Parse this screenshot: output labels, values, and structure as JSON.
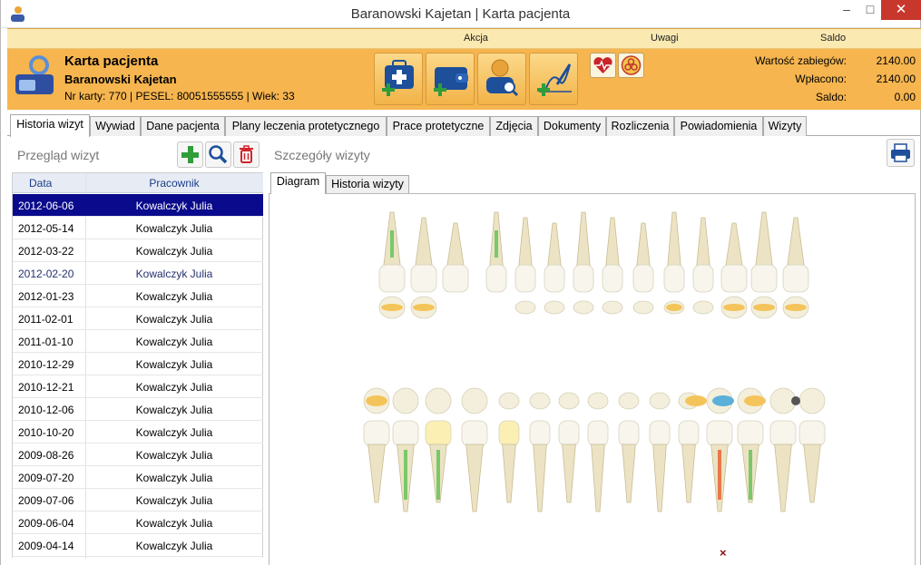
{
  "window": {
    "title": "Baranowski Kajetan | Karta pacjenta",
    "minimize": "–",
    "maximize": "□",
    "close": "✕"
  },
  "header": {
    "col_akcja": "Akcja",
    "col_uwagi": "Uwagi",
    "col_saldo": "Saldo",
    "card_title": "Karta pacjenta",
    "patient_name": "Baranowski Kajetan",
    "patient_info": "Nr karty: 770 | PESEL: 80051555555 | Wiek: 33",
    "actions": [
      "add-medical-kit-icon",
      "add-wallet-icon",
      "search-user-icon",
      "add-signature-icon"
    ],
    "notes": [
      "heart-pulse-icon",
      "biohazard-icon"
    ],
    "summary": [
      {
        "label": "Wartość zabiegów:",
        "value": "2140.00"
      },
      {
        "label": "Wpłacono:",
        "value": "2140.00"
      },
      {
        "label": "Saldo:",
        "value": "0.00"
      }
    ]
  },
  "tabs": [
    "Historia wizyt",
    "Wywiad",
    "Dane pacjenta",
    "Plany leczenia protetycznego",
    "Prace protetyczne",
    "Zdjęcia",
    "Dokumenty",
    "Rozliczenia",
    "Powiadomienia",
    "Wizyty"
  ],
  "active_tab": "Historia wizyt",
  "visits": {
    "title": "Przegląd wizyt",
    "columns": [
      "Data",
      "Pracownik"
    ],
    "rows": [
      {
        "date": "2012-06-06",
        "employee": "Kowalczyk Julia"
      },
      {
        "date": "2012-05-14",
        "employee": "Kowalczyk Julia"
      },
      {
        "date": "2012-03-22",
        "employee": "Kowalczyk Julia"
      },
      {
        "date": "2012-02-20",
        "employee": "Kowalczyk Julia"
      },
      {
        "date": "2012-01-23",
        "employee": "Kowalczyk Julia"
      },
      {
        "date": "2011-02-01",
        "employee": "Kowalczyk Julia"
      },
      {
        "date": "2011-01-10",
        "employee": "Kowalczyk Julia"
      },
      {
        "date": "2010-12-29",
        "employee": "Kowalczyk Julia"
      },
      {
        "date": "2010-12-21",
        "employee": "Kowalczyk Julia"
      },
      {
        "date": "2010-12-06",
        "employee": "Kowalczyk Julia"
      },
      {
        "date": "2010-10-20",
        "employee": "Kowalczyk Julia"
      },
      {
        "date": "2009-08-26",
        "employee": "Kowalczyk Julia"
      },
      {
        "date": "2009-07-20",
        "employee": "Kowalczyk Julia"
      },
      {
        "date": "2009-07-06",
        "employee": "Kowalczyk Julia"
      },
      {
        "date": "2009-06-04",
        "employee": "Kowalczyk Julia"
      },
      {
        "date": "2009-04-14",
        "employee": "Kowalczyk Julia"
      }
    ],
    "selected_index": 0
  },
  "details": {
    "title": "Szczegóły wizyty",
    "subtabs": [
      "Diagram",
      "Historia wizyty"
    ],
    "active_subtab": "Diagram",
    "diagram_mark": "×"
  },
  "colors": {
    "header_orange": "#f6b54f",
    "selection_blue": "#0a0a8c",
    "filling_yellow": "#f4c45a",
    "filling_blue": "#5ab0d8",
    "root_canal_green": "#7ac86a",
    "root_canal_orange": "#e8784a",
    "mark_red": "#8a1010"
  }
}
